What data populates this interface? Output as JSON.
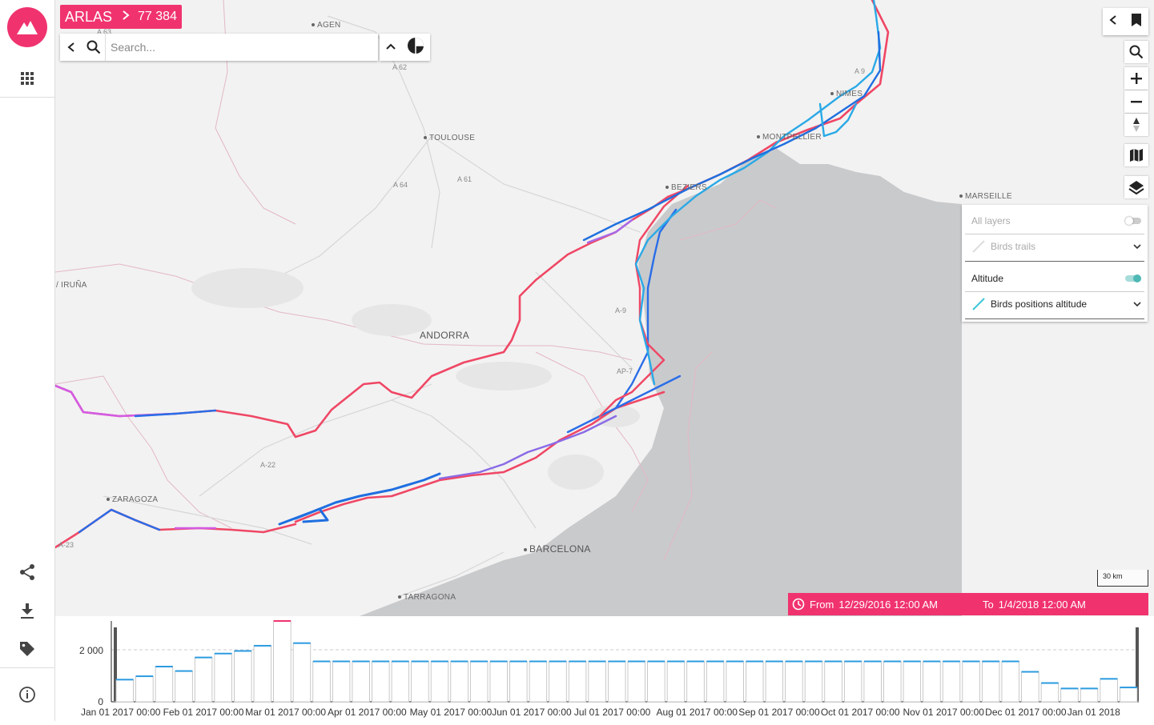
{
  "app": {
    "name": "ARLAS",
    "count": "77 384"
  },
  "search": {
    "placeholder": "Search..."
  },
  "cities": {
    "agen": "AGEN",
    "toulouse": "TOULOUSE",
    "montpellier": "MONTPELLIER",
    "nimes": "NIMES",
    "beziers": "BEZIERS",
    "marseille": "MARSEILLE",
    "andorra": "ANDORRA",
    "zaragoza": "ZARAGOZA",
    "barcelona": "BARCELONA",
    "tarragona": "TARRAGONA",
    "iruna": "/ IRUÑA"
  },
  "roads": {
    "a62": "A 62",
    "a64": "A 64",
    "a61": "A 61",
    "a22": "A-22",
    "ap7": "AP-7",
    "a9": "A 9",
    "a9b": "A-9",
    "a23": "A-23",
    "a63": "A 63"
  },
  "layers": {
    "all": "All layers",
    "trails": "Birds trails",
    "group": "Altitude",
    "positions": "Birds positions altitude"
  },
  "scale": "30 km",
  "timerange": {
    "from_label": "From",
    "from": "12/29/2016 12:00 AM",
    "to_label": "To",
    "to": "1/4/2018 12:00 AM"
  },
  "colors": {
    "brand": "#f0336f",
    "bar": "#2c9be0",
    "accent_toggle": "#4fb8b5"
  },
  "histogram": {
    "y_tick": "2 000",
    "y_zero": "0",
    "y_tick_value": 2000,
    "y_max": 3100,
    "values": [
      850,
      980,
      1350,
      1180,
      1700,
      1850,
      1950,
      2150,
      3100,
      2250,
      1550,
      1550,
      1550,
      1550,
      1550,
      1550,
      1550,
      1550,
      1550,
      1550,
      1550,
      1550,
      1550,
      1550,
      1550,
      1550,
      1550,
      1550,
      1550,
      1550,
      1550,
      1550,
      1550,
      1550,
      1550,
      1550,
      1550,
      1550,
      1550,
      1550,
      1550,
      1550,
      1550,
      1550,
      1550,
      1550,
      1150,
      720,
      510,
      510,
      880,
      550
    ],
    "x_labels": [
      "Jan 01 2017 00:00",
      "Feb 01 2017 00:00",
      "Mar 01 2017 00:00",
      "Apr 01 2017 00:00",
      "May 01 2017 00:00",
      "Jun 01 2017 00:00",
      "Jul 01 2017 00:00",
      "Aug 01 2017 00:00",
      "Sep 01 2017 00:00",
      "Oct 01 2017 00:00",
      "Nov 01 2017 00:00",
      "Dec 01 2017 00:00",
      "Jan 01 2018"
    ]
  }
}
